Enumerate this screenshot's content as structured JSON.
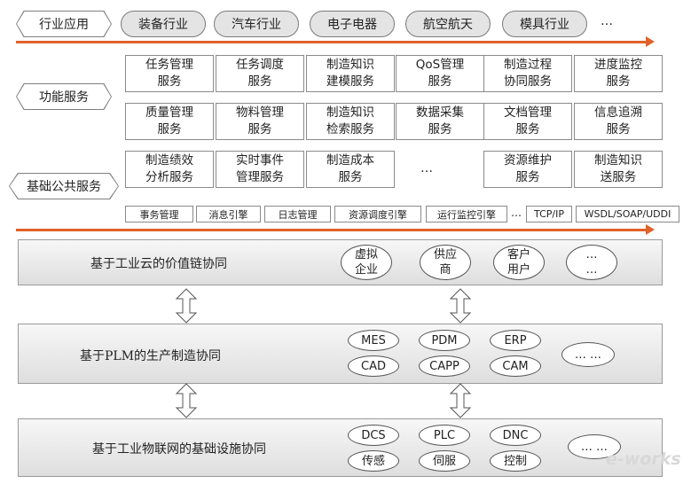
{
  "industry": {
    "label": "行业应用",
    "items": [
      "装备行业",
      "汽车行业",
      "电子电器",
      "航空航天",
      "模具行业"
    ],
    "more": "…"
  },
  "function_services": {
    "label": "功能服务",
    "rows": [
      [
        "任务管理\n服务",
        "任务调度\n服务",
        "制造知识\n建模服务",
        "QoS管理\n服务",
        "制造过程\n协同服务",
        "进度监控\n服务"
      ],
      [
        "质量管理\n服务",
        "物料管理\n服务",
        "制造知识\n检索服务",
        "数据采集\n服务",
        "文档管理\n服务",
        "信息追溯\n服务"
      ]
    ]
  },
  "basic_services": {
    "label": "基础公共服务",
    "row": [
      "制造绩效\n分析服务",
      "实时事件\n管理服务",
      "制造成本\n服务",
      "…",
      "资源维护\n服务",
      "制造知识\n送服务"
    ],
    "engines": [
      "事务管理",
      "消息引擎",
      "日志管理",
      "资源调度引擎",
      "运行监控引擎",
      "…",
      "TCP/IP",
      "WSDL/SOAP/UDDI"
    ]
  },
  "layers": [
    {
      "title": "基于工业云的价值链协同",
      "items": [
        "虚拟\n企业",
        "供应\n商",
        "客户\n用户",
        "…\n…"
      ]
    },
    {
      "title": "基于PLM的生产制造协同",
      "items": [
        "MES",
        "PDM",
        "ERP",
        "CAD",
        "CAPP",
        "CAM",
        "… …"
      ]
    },
    {
      "title": "基于工业物联网的基础设施协同",
      "items": [
        "DCS",
        "PLC",
        "DNC",
        "传感",
        "伺服",
        "控制",
        "… …"
      ]
    }
  ],
  "watermark": "e-works",
  "colors": {
    "arrow": "#e0622a",
    "panel": "#e6e6e6"
  }
}
